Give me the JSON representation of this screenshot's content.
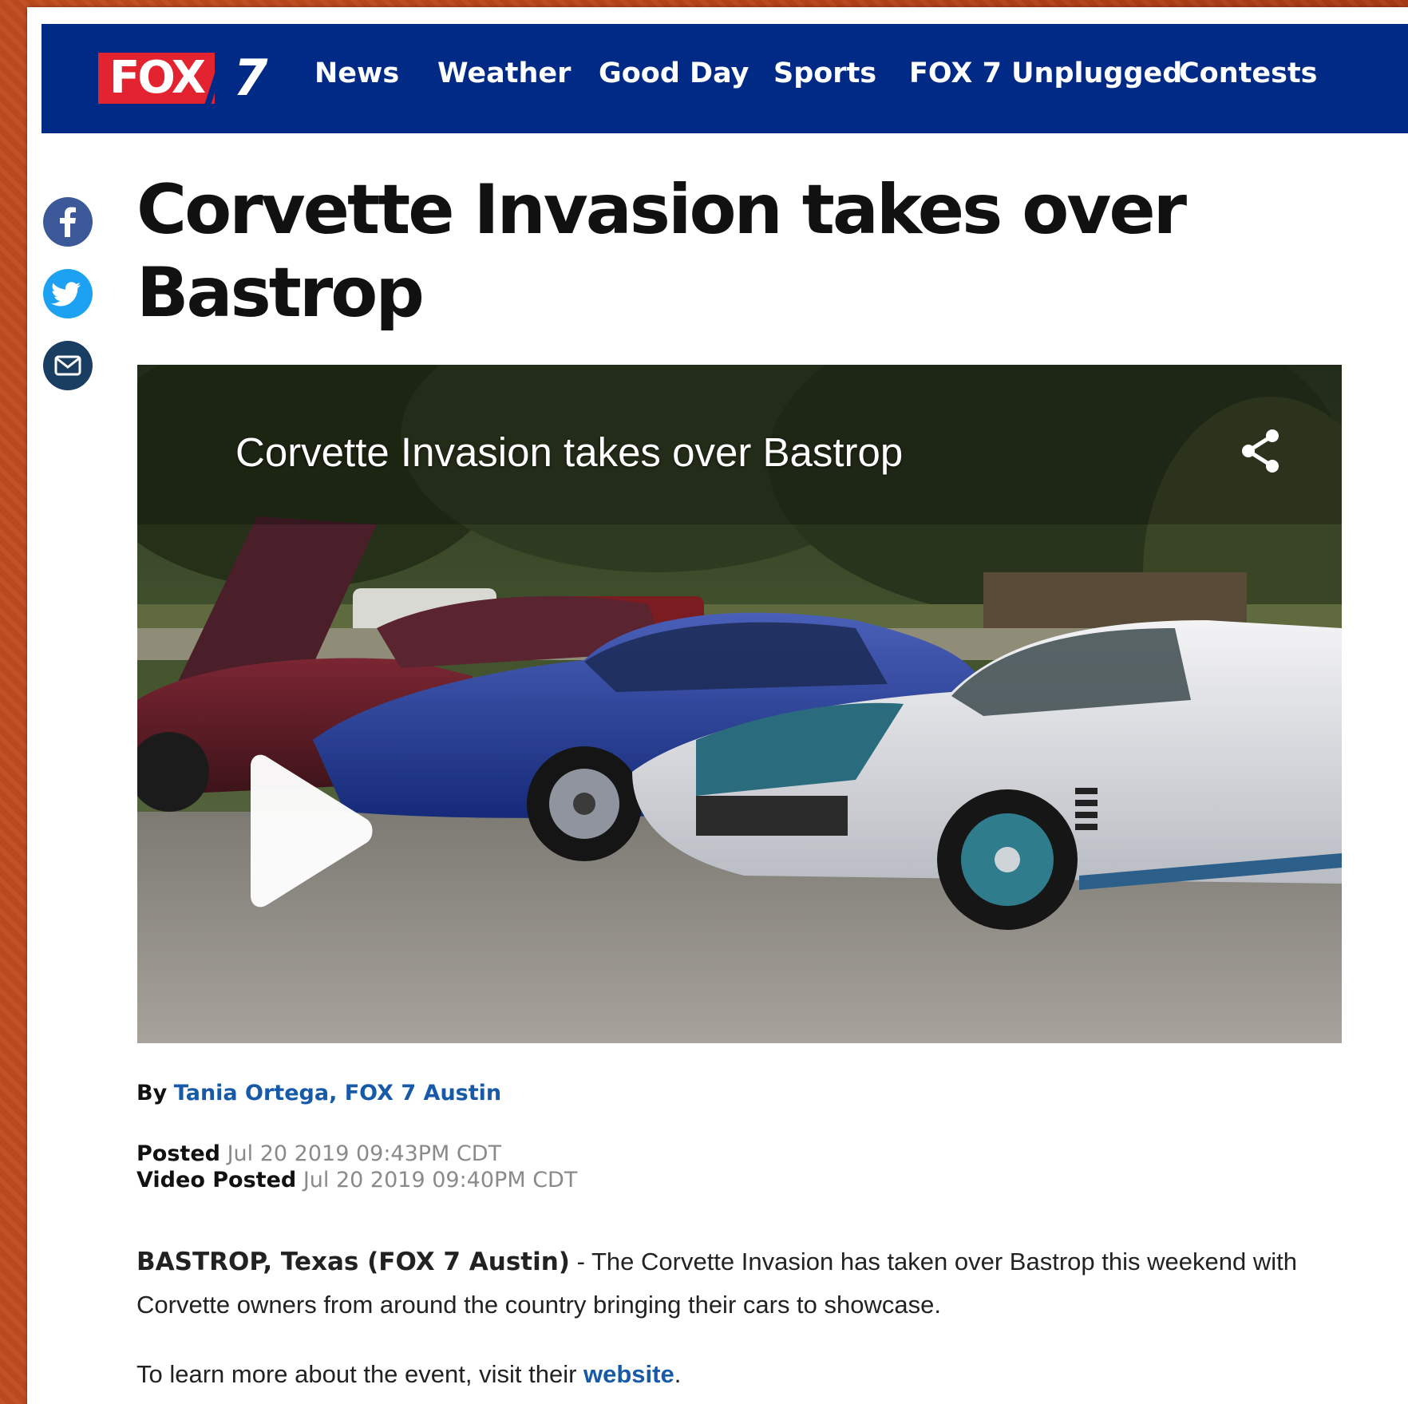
{
  "nav": {
    "logo_fox": "FOX",
    "logo_number": "7",
    "items": [
      "News",
      "Weather",
      "Good Day",
      "Sports",
      "FOX 7 Unplugged",
      "Contests"
    ]
  },
  "article": {
    "headline_line1": "Corvette Invasion takes over",
    "headline_line2": "Bastrop",
    "video_title": "Corvette Invasion takes over Bastrop",
    "by_label": "By",
    "author": "Tania Ortega, FOX 7 Austin",
    "posted_label": "Posted",
    "posted_value": "Jul 20 2019 09:43PM CDT",
    "video_posted_label": "Video Posted",
    "video_posted_value": "Jul 20 2019 09:40PM CDT",
    "dateline": "BASTROP, Texas (FOX 7 Austin)",
    "paragraph1": " - The Corvette Invasion has taken over Bastrop this weekend with Corvette owners from around the country bringing their cars to showcase.",
    "paragraph2_prefix": "To learn more about the event, visit their ",
    "paragraph2_link": "website",
    "paragraph2_suffix": "."
  },
  "social": {
    "icons": [
      "facebook-icon",
      "twitter-icon",
      "email-icon"
    ],
    "colors": {
      "facebook": "#3b5998",
      "twitter": "#1da1f2",
      "email": "#1a3d62"
    }
  },
  "colors": {
    "nav_bg": "#012a87",
    "logo_red": "#e32330",
    "link_blue": "#175aa8",
    "page_border_orange": "#b8491f"
  }
}
